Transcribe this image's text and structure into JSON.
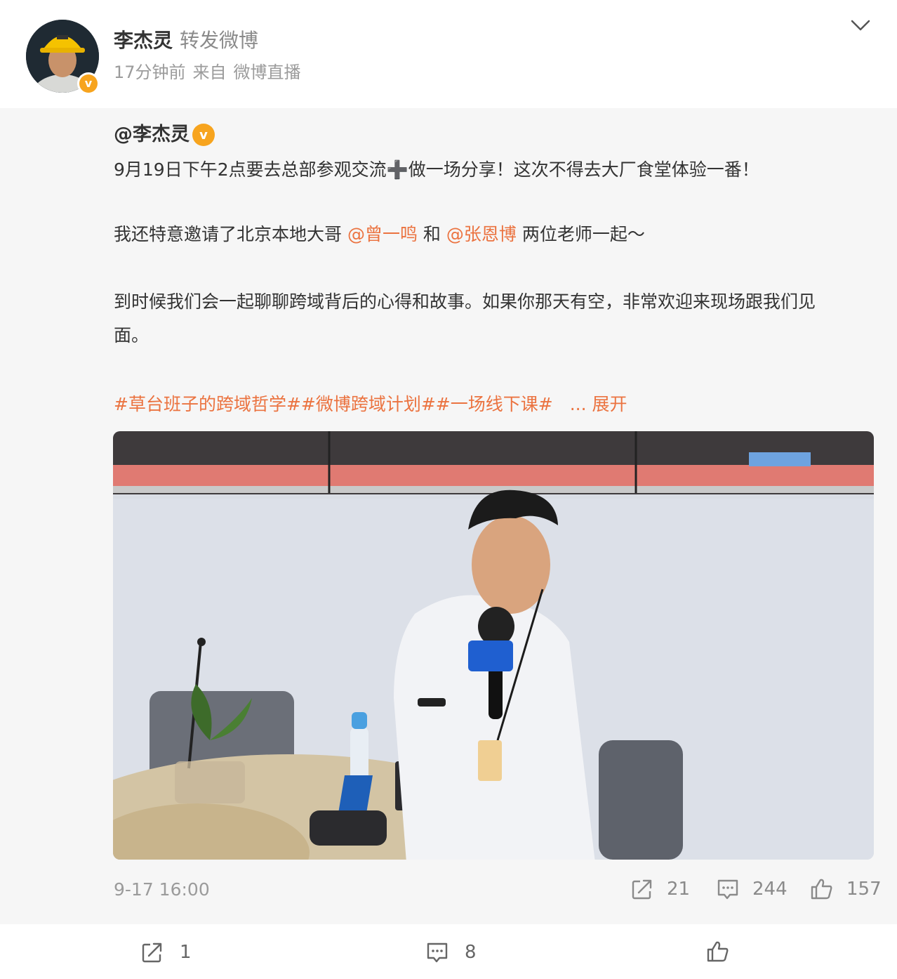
{
  "post": {
    "user_name": "李杰灵",
    "action_label": "转发微博",
    "time_ago": "17分钟前",
    "source_prefix": "来自",
    "source": "微博直播",
    "avatar_icon": "avatar-hardhat-portrait",
    "verified_icon": "verified-v-icon",
    "verified_glyph": "v",
    "more_icon": "chevron-down-icon"
  },
  "quoted": {
    "user": "@李杰灵",
    "verified_glyph": "v",
    "line1_a": "9月19日下午2点要去总部参观交流",
    "line1_plus": "➕",
    "line1_b": "做一场分享！这次不得去大厂食堂体验一番！",
    "line2_a": "我还特意邀请了北京本地大哥 ",
    "mention1": "@曾一鸣",
    "line2_b": " 和 ",
    "mention2": "@张恩博",
    "line2_c": " 两位老师一起～",
    "line3": "到时候我们会一起聊聊跨域背后的心得和故事。如果你那天有空，非常欢迎来现场跟我们见",
    "line4": "面。",
    "hashtags": "#草台班子的跨域哲学##微博跨域计划##一场线下课#",
    "expand": "... 展开",
    "image_alt": "演讲者手持麦克风在会议室分享",
    "timestamp": "9-17 16:00",
    "reposts": "21",
    "comments": "244",
    "likes": "157"
  },
  "footer": {
    "reposts": "1",
    "comments": "8",
    "likes": ""
  },
  "colors": {
    "accent": "#eb7340",
    "verified": "#f7a41e",
    "quoted_bg": "#f6f6f6",
    "muted_text": "#9b9b9b"
  }
}
